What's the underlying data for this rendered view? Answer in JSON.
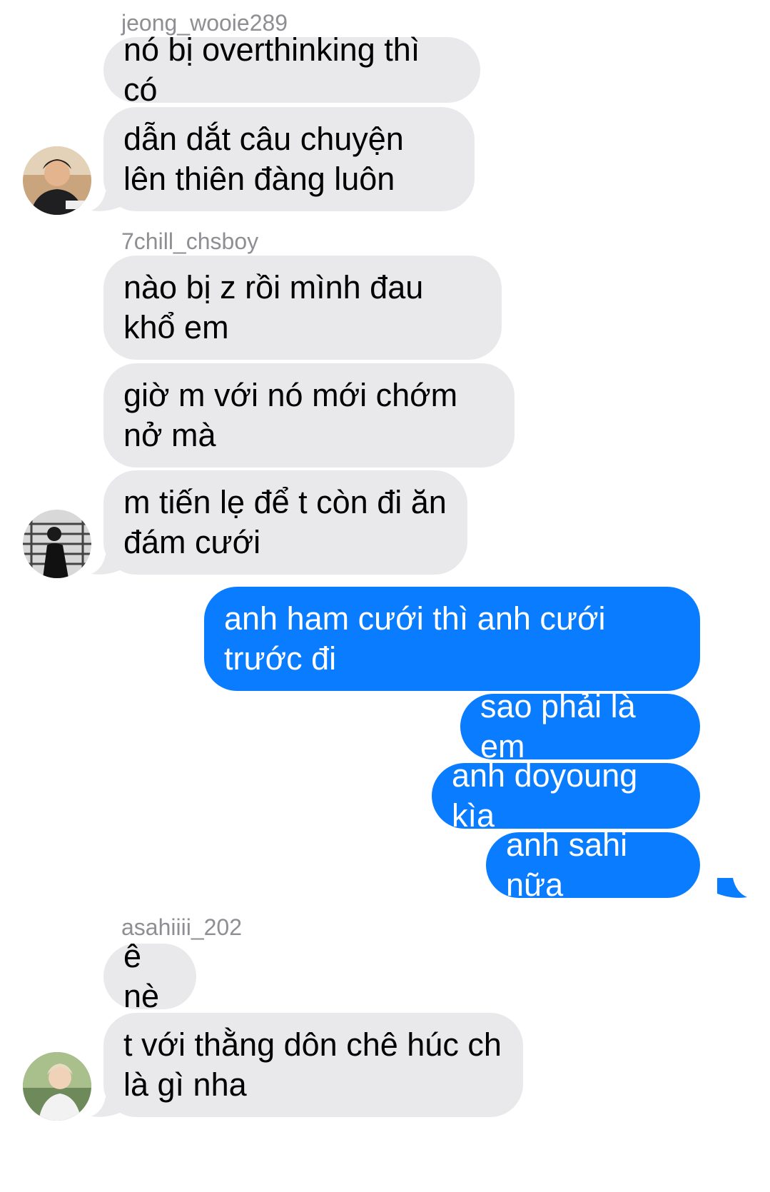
{
  "conversation": {
    "groups": [
      {
        "sender": "jeong_wooie289",
        "avatar_icon": "user-avatar-icon",
        "messages": [
          "nó bị overthinking thì có",
          "dẫn dắt câu chuyện lên thiên đàng luôn"
        ]
      },
      {
        "sender": "7chill_chsboy",
        "avatar_icon": "user-avatar-icon",
        "messages": [
          "nào bị z rồi mình đau khổ em",
          "giờ m với nó mới chớm nở mà",
          "m tiến lẹ để t còn đi ăn đám cưới"
        ]
      },
      {
        "sender": "",
        "outgoing": true,
        "messages": [
          "anh ham cưới thì anh cưới trước đi",
          "sao phải là em",
          "anh doyoung kìa",
          "anh sahi nữa"
        ]
      },
      {
        "sender": "asahiiii_202",
        "avatar_icon": "user-avatar-icon",
        "messages": [
          "ê nè",
          "t với thằng dôn chê húc ch là gì nha"
        ]
      }
    ]
  },
  "colors": {
    "incoming_bubble": "#e9e9eb",
    "outgoing_bubble": "#0a7cff",
    "sender_name": "#8e8e93"
  }
}
